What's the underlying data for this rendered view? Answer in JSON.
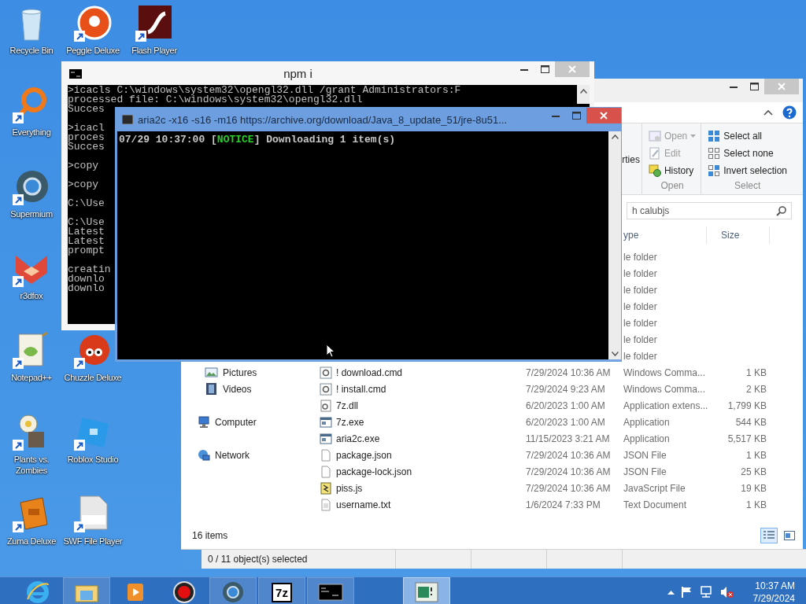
{
  "desktop_icons": [
    {
      "label": "Recycle Bin",
      "kind": "recycle",
      "shortcut": false
    },
    {
      "label": "Peggle Deluxe",
      "kind": "peggle",
      "shortcut": true
    },
    {
      "label": "Flash Player",
      "kind": "flash",
      "shortcut": true
    },
    {
      "label": "Everything",
      "kind": "everything",
      "shortcut": true
    },
    {
      "label": "Supermium",
      "kind": "supermium",
      "shortcut": true
    },
    {
      "label": "r3dfox",
      "kind": "fox",
      "shortcut": true
    },
    {
      "label": "Notepad++",
      "kind": "notepad",
      "shortcut": true
    },
    {
      "label": "Chuzzle Deluxe",
      "kind": "chuzzle",
      "shortcut": true
    },
    {
      "label": "Plants vs. Zombies",
      "kind": "plants",
      "shortcut": true
    },
    {
      "label": "Roblox Studio",
      "kind": "roblox",
      "shortcut": true
    },
    {
      "label": "Zuma Deluxe",
      "kind": "zuma",
      "shortcut": true
    },
    {
      "label": "SWF File Player",
      "kind": "swf",
      "shortcut": true
    }
  ],
  "explorer": {
    "ribbon": {
      "fragment": "rties",
      "groups": [
        {
          "label": "Open",
          "items": [
            {
              "label": "Open",
              "kind": "open",
              "disabled": true
            },
            {
              "label": "Edit",
              "kind": "edit",
              "disabled": true
            },
            {
              "label": "History",
              "kind": "history",
              "disabled": false
            }
          ]
        },
        {
          "label": "Select",
          "items": [
            {
              "label": "Select all",
              "kind": "select-all",
              "disabled": false
            },
            {
              "label": "Select none",
              "kind": "select-none",
              "disabled": false
            },
            {
              "label": "Invert selection",
              "kind": "invert",
              "disabled": false
            }
          ]
        }
      ]
    },
    "search": {
      "placeholder": "h calubjs"
    },
    "columns": [
      "ype",
      "Size"
    ],
    "nav": [
      {
        "label": "Pictures",
        "kind": "pictures"
      },
      {
        "label": "Videos",
        "kind": "videos"
      },
      {
        "label": "Computer",
        "kind": "computer"
      },
      {
        "label": "Network",
        "kind": "network"
      }
    ],
    "rows": [
      {
        "type": "le folder"
      },
      {
        "type": "le folder"
      },
      {
        "type": "le folder"
      },
      {
        "type": "le folder"
      },
      {
        "type": "le folder"
      },
      {
        "type": "le folder"
      },
      {
        "type": "le folder"
      },
      {
        "name": "! download.cmd",
        "kind": "cmd",
        "date": "7/29/2024 10:36 AM",
        "type": "Windows Comma...",
        "size": "1 KB"
      },
      {
        "name": "! install.cmd",
        "kind": "cmd",
        "date": "7/29/2024 9:23 AM",
        "type": "Windows Comma...",
        "size": "2 KB"
      },
      {
        "name": "7z.dll",
        "kind": "dll",
        "date": "6/20/2023 1:00 AM",
        "type": "Application extens...",
        "size": "1,799 KB"
      },
      {
        "name": "7z.exe",
        "kind": "exe",
        "date": "6/20/2023 1:00 AM",
        "type": "Application",
        "size": "544 KB"
      },
      {
        "name": "aria2c.exe",
        "kind": "exe",
        "date": "11/15/2023 3:21 AM",
        "type": "Application",
        "size": "5,517 KB"
      },
      {
        "name": "package.json",
        "kind": "json",
        "date": "7/29/2024 10:36 AM",
        "type": "JSON File",
        "size": "1 KB"
      },
      {
        "name": "package-lock.json",
        "kind": "json",
        "date": "7/29/2024 10:36 AM",
        "type": "JSON File",
        "size": "25 KB"
      },
      {
        "name": "piss.js",
        "kind": "js",
        "date": "7/29/2024 10:36 AM",
        "type": "JavaScript File",
        "size": "19 KB"
      },
      {
        "name": "username.txt",
        "kind": "txt",
        "date": "1/6/2024 7:33 PM",
        "type": "Text Document",
        "size": "1 KB"
      }
    ],
    "item_count": "16 items",
    "views": [
      {
        "kind": "details",
        "selected": true
      },
      {
        "kind": "tiles",
        "selected": false
      }
    ]
  },
  "status_strip": {
    "text": "0 / 11 object(s) selected"
  },
  "cmd_window": {
    "title": "npm i",
    "blocks": [
      [
        ">icacls C:\\windows\\system32\\opengl32.dll /grant Administrators:F",
        "processed file: C:\\windows\\system32\\opengl32.dll",
        "Succes"
      ],
      [
        ">icacl",
        "proces",
        "Succes"
      ],
      [
        ">copy"
      ],
      [
        ">copy"
      ],
      [
        "C:\\Use"
      ],
      [
        "C:\\Use",
        "Latest",
        "Latest",
        "prompt"
      ],
      [
        "creatin",
        "downlo",
        "downlo"
      ]
    ]
  },
  "aria_window": {
    "title": "aria2c -x16 -s16 -m16 https://archive.org/download/Java_8_update_51/jre-8u51...",
    "line": {
      "before": "07/29 10:37:00 [",
      "tag": "NOTICE",
      "after": "] Downloading 1 item(s)"
    }
  },
  "taskbar": {
    "items": [
      {
        "kind": "ie",
        "running": false,
        "selected": false
      },
      {
        "kind": "explorer",
        "running": true,
        "selected": false
      },
      {
        "kind": "media",
        "running": false,
        "selected": false
      },
      {
        "kind": "record",
        "running": false,
        "selected": false
      },
      {
        "kind": "supermium",
        "running": true,
        "selected": false
      },
      {
        "kind": "archive",
        "glyph": "7z",
        "running": true,
        "selected": false
      },
      {
        "kind": "cmd",
        "running": true,
        "selected": false
      },
      {
        "kind": "window",
        "running": true,
        "selected": true
      }
    ],
    "time": "10:37 AM",
    "date": "7/29/2024"
  }
}
